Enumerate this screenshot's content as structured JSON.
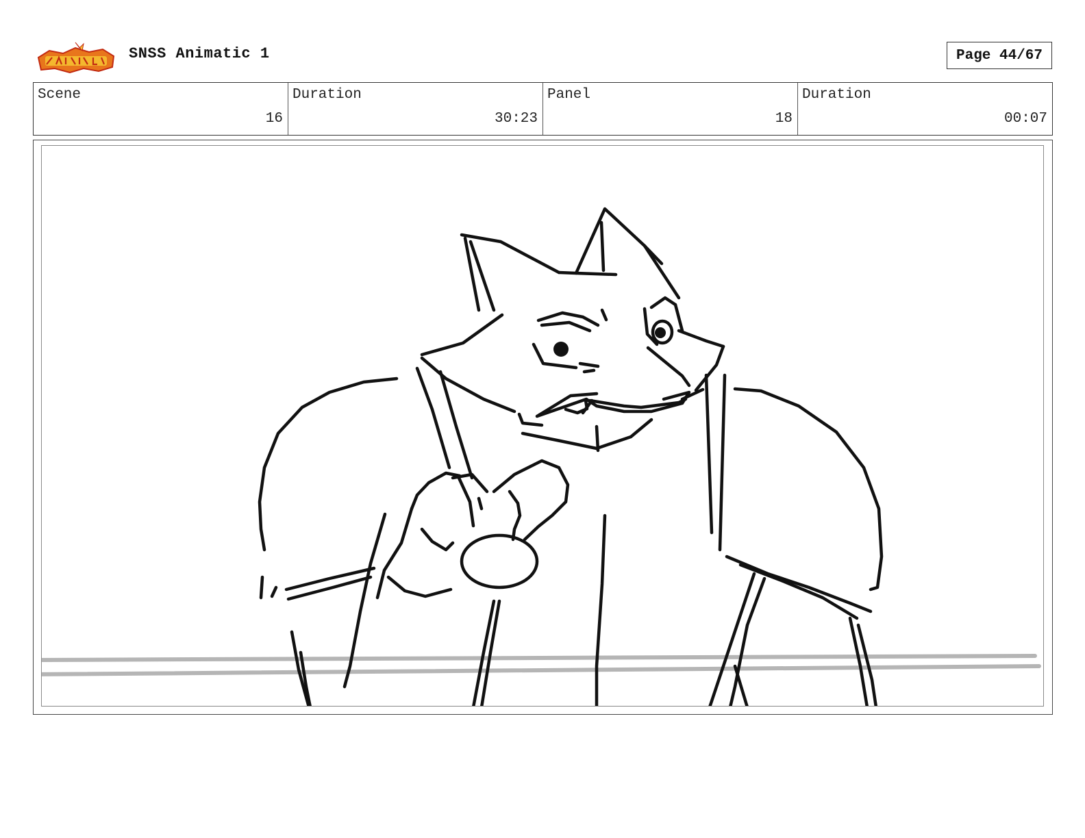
{
  "header": {
    "logo_text": "Sir Not-So-Sleep",
    "title": "SNSS Animatic 1",
    "page": "Page 44/67"
  },
  "info": {
    "scene_label": "Scene",
    "scene_value": "16",
    "scene_duration_label": "Duration",
    "scene_duration_value": "30:23",
    "panel_label": "Panel",
    "panel_value": "18",
    "panel_duration_label": "Duration",
    "panel_duration_value": "00:07"
  },
  "colors": {
    "logo_orange": "#e8761c",
    "logo_red": "#c22a12",
    "logo_yellow": "#f6c431",
    "sketch_line": "#111111",
    "ground_line": "#b5b5b5"
  }
}
